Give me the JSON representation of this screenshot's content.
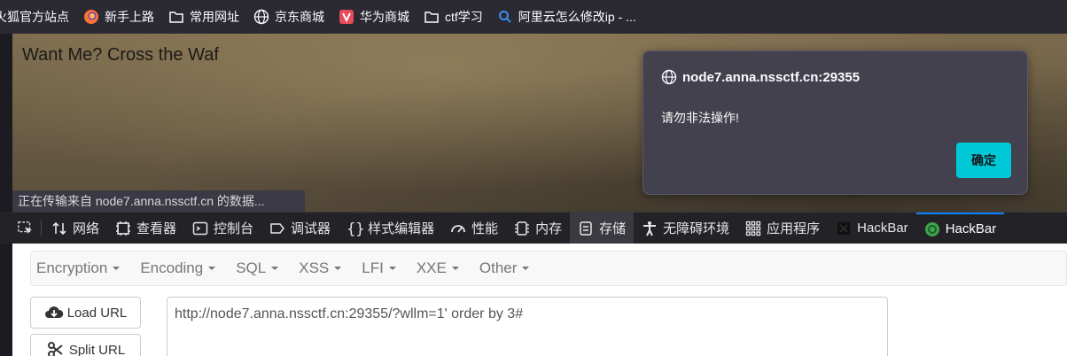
{
  "bookmarks": [
    {
      "label": "火狐官方站点",
      "icon": "firefox-partial-icon"
    },
    {
      "label": "新手上路",
      "icon": "firefox-icon"
    },
    {
      "label": "常用网址",
      "icon": "folder-icon"
    },
    {
      "label": "京东商城",
      "icon": "globe-icon"
    },
    {
      "label": "华为商城",
      "icon": "vmall-icon"
    },
    {
      "label": "ctf学习",
      "icon": "folder-icon"
    },
    {
      "label": "阿里云怎么修改ip - ...",
      "icon": "search-icon"
    }
  ],
  "page": {
    "heading": "Want Me? Cross the Waf",
    "status": "正在传输来自 node7.anna.nssctf.cn 的数据..."
  },
  "dialog": {
    "origin": "node7.anna.nssctf.cn:29355",
    "message": "请勿非法操作!",
    "ok_label": "确定"
  },
  "devtools": {
    "tabs": [
      {
        "label": "网络",
        "icon": "network-icon"
      },
      {
        "label": "查看器",
        "icon": "inspector-icon"
      },
      {
        "label": "控制台",
        "icon": "console-icon"
      },
      {
        "label": "调试器",
        "icon": "debugger-icon"
      },
      {
        "label": "样式编辑器",
        "icon": "style-editor-icon"
      },
      {
        "label": "性能",
        "icon": "performance-icon"
      },
      {
        "label": "内存",
        "icon": "memory-icon"
      },
      {
        "label": "存储",
        "icon": "storage-icon"
      },
      {
        "label": "无障碍环境",
        "icon": "accessibility-icon"
      },
      {
        "label": "应用程序",
        "icon": "application-icon"
      },
      {
        "label": "HackBar",
        "icon": "hackbar-icon"
      },
      {
        "label": "HackBar",
        "icon": "hackbar-green-icon"
      }
    ]
  },
  "hackbar": {
    "menu": [
      "Encryption",
      "Encoding",
      "SQL",
      "XSS",
      "LFI",
      "XXE",
      "Other"
    ],
    "load_url_label": "Load URL",
    "split_url_label": "Split URL",
    "url_value": "http://node7.anna.nssctf.cn:29355/?wllm=1' order by 3#"
  },
  "colors": {
    "accent": "#00c8d7",
    "devtools_active": "#0a84ff",
    "dialog_bg": "#42414d"
  }
}
